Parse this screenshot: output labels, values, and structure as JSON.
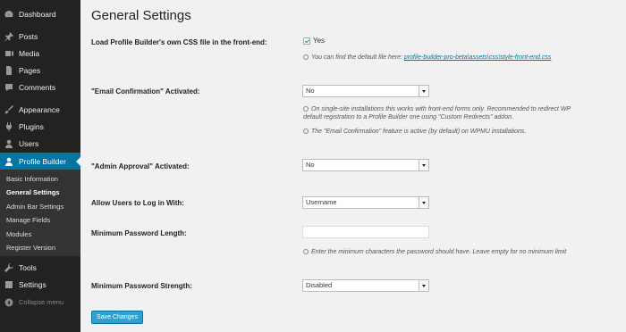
{
  "sidebar": {
    "items": [
      {
        "label": "Dashboard",
        "icon": "dashboard-icon"
      },
      {
        "label": "Posts",
        "icon": "pin-icon"
      },
      {
        "label": "Media",
        "icon": "media-icon"
      },
      {
        "label": "Pages",
        "icon": "page-icon"
      },
      {
        "label": "Comments",
        "icon": "comment-icon"
      },
      {
        "label": "Appearance",
        "icon": "brush-icon"
      },
      {
        "label": "Plugins",
        "icon": "plugin-icon"
      },
      {
        "label": "Users",
        "icon": "user-icon"
      },
      {
        "label": "Profile Builder",
        "icon": "profile-icon"
      },
      {
        "label": "Tools",
        "icon": "wrench-icon"
      },
      {
        "label": "Settings",
        "icon": "settings-icon"
      }
    ],
    "submenu": [
      "Basic Information",
      "General Settings",
      "Admin Bar Settings",
      "Manage Fields",
      "Modules",
      "Register Version"
    ],
    "collapse_label": "Collapse menu"
  },
  "page": {
    "title": "General Settings",
    "css_label": "Load Profile Builder's own CSS file in the front-end:",
    "css_checkbox_label": "Yes",
    "css_note_prefix": "You can find the default file here:",
    "css_note_link": "profile-builder-pro-beta\\assets\\css\\style-front-end.css",
    "email_label": "\"Email Confirmation\" Activated:",
    "email_value": "No",
    "email_note1a": "On single-site installations this works with front-end forms only. Recommended to redirect WP",
    "email_note1b": "default registration to a Profile Builder one using \"Custom Redirects\" addon.",
    "email_note2": "The \"Email Confirmation\" feature is active (by default) on WPMU installations.",
    "approval_label": "\"Admin Approval\" Activated:",
    "approval_value": "No",
    "login_label": "Allow Users to Log in With:",
    "login_value": "Username",
    "pwlen_label": "Minimum Password Length:",
    "pwlen_value": "",
    "pwlen_note": "Enter the minimum characters the password should have. Leave empty for no minimum limit",
    "pwstr_label": "Minimum Password Strength:",
    "pwstr_value": "Disabled",
    "save_label": "Save Changes"
  },
  "colors": {
    "sidebar_bg": "#222222",
    "active_bg": "#0074a2",
    "button": "#2ea2cc",
    "link": "#0074a2"
  }
}
